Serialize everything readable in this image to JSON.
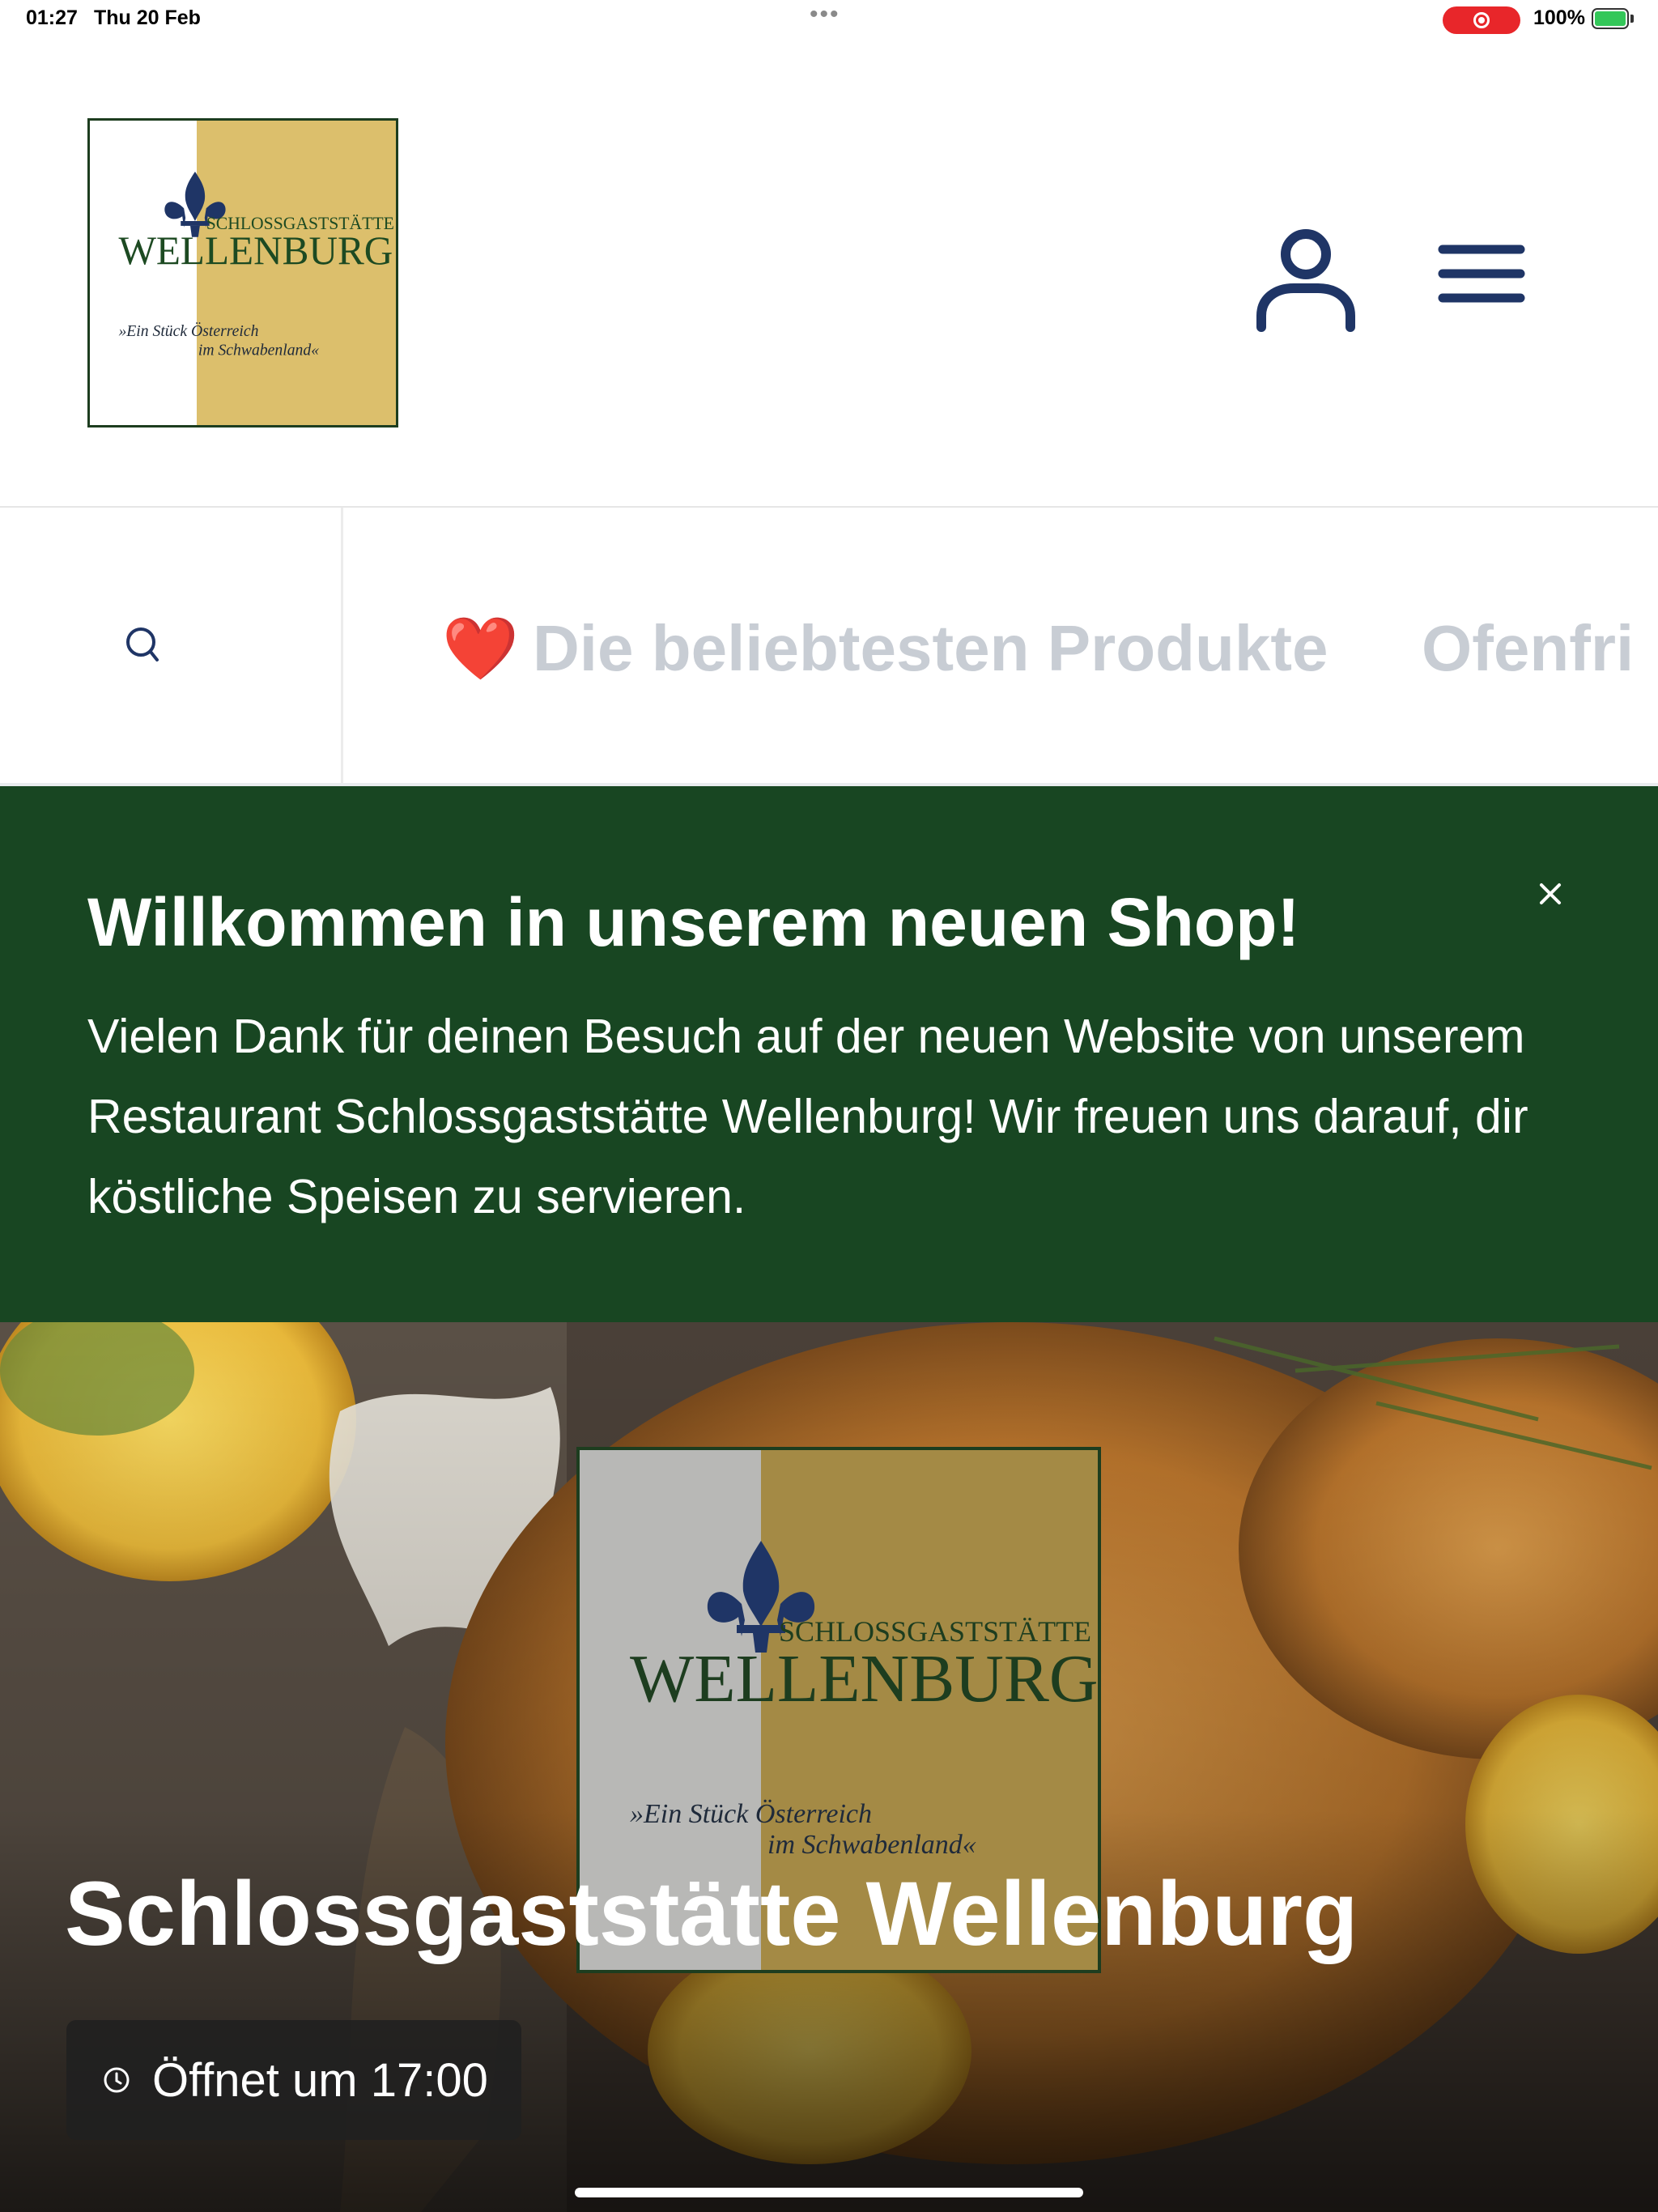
{
  "status_bar": {
    "time": "01:27",
    "date": "Thu 20 Feb",
    "battery": "100%"
  },
  "header": {
    "logo": {
      "line1": "SCHLOSSGASTSTÄTTE",
      "line2": "WELLENBURG",
      "tagline1": "»Ein Stück Österreich",
      "tagline2": "im Schwabenland«"
    },
    "user_icon": "user-icon",
    "menu_icon": "hamburger-menu-icon"
  },
  "nav": {
    "search_icon": "search-icon",
    "heart": "❤️",
    "items": [
      "Die beliebtesten Produkte",
      "Ofenfri"
    ]
  },
  "banner": {
    "title": "Willkommen in unserem neuen Shop!",
    "text": "Vielen Dank für deinen Besuch auf der neuen Website von unserem Restaurant Schlossgaststätte Wellenburg! Wir freuen uns darauf, dir köstliche Speisen zu servieren.",
    "close_icon": "close-icon"
  },
  "hero": {
    "title": "Schlossgaststätte Wellenburg",
    "opening": "Öffnet um 17:00",
    "clock_icon": "clock-icon"
  },
  "colors": {
    "brand_green": "#184622",
    "logo_gold": "#dcbf6c",
    "logo_blue": "#1f3566",
    "icon_navy": "#1f3566",
    "nav_text": "#c8cdd4"
  }
}
